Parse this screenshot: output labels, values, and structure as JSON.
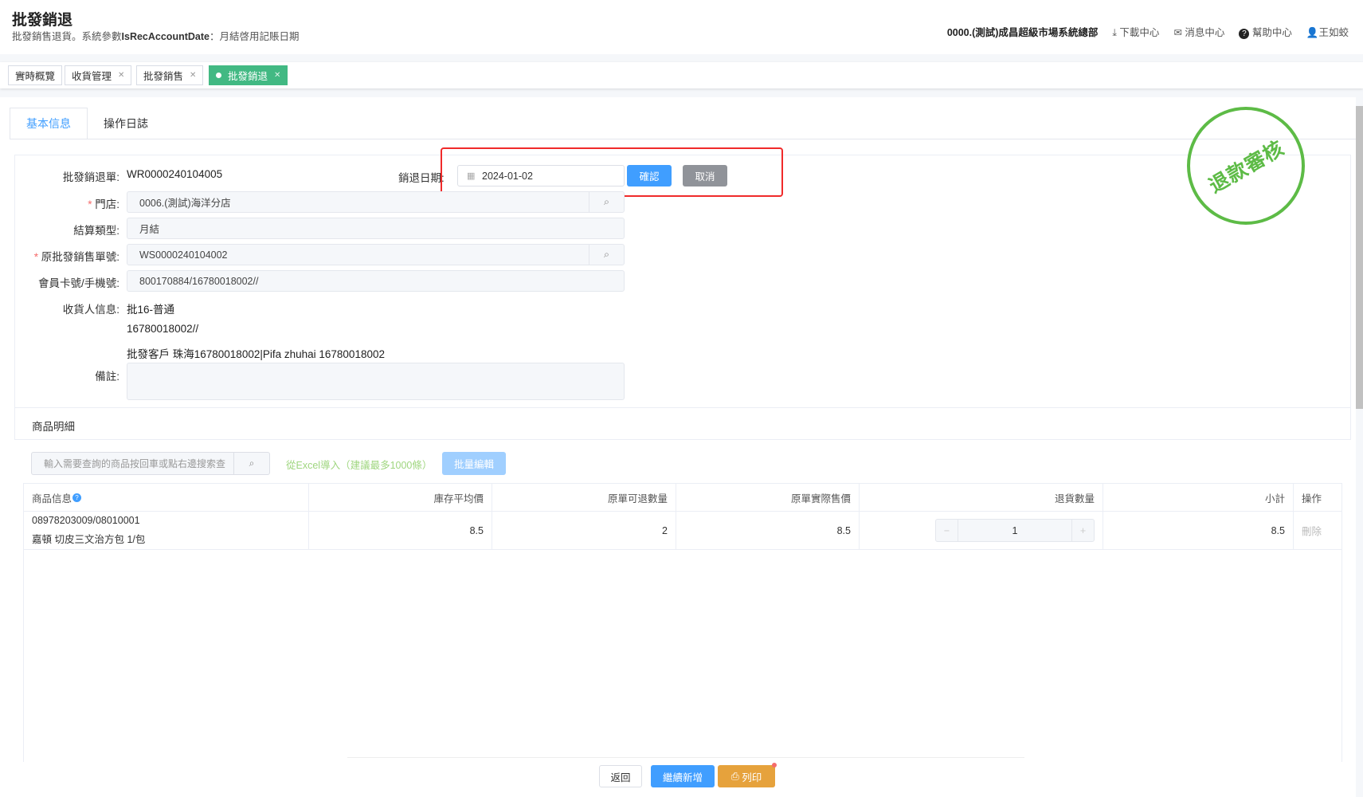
{
  "header": {
    "title": "批發銷退",
    "subtitle_prefix": "批發銷售退貨。系統參數",
    "subtitle_param": "IsRecAccountDate",
    "subtitle_suffix": "：月結啓用記賬日期",
    "org": "0000.(測試)成昌超級市場系統總部",
    "download": "下載中心",
    "messages": "消息中心",
    "help": "幫助中心",
    "user": "王如蛟"
  },
  "tabs": [
    {
      "label": "實時概覽"
    },
    {
      "label": "收貨管理"
    },
    {
      "label": "批發銷售"
    },
    {
      "label": "批發銷退",
      "active": true
    }
  ],
  "content_tabs": [
    "基本信息",
    "操作日誌"
  ],
  "form": {
    "order_label": "批發銷退單:",
    "order_value": "WR0000240104005",
    "date_label": "銷退日期:",
    "date_value": "2024-01-02",
    "confirm": "確認",
    "cancel": "取消",
    "store_label": "門店:",
    "store_value": "0006.(測試)海洋分店",
    "settle_label": "結算類型:",
    "settle_value": "月結",
    "orig_label": "原批發銷售單號:",
    "orig_value": "WS0000240104002",
    "member_label": "會員卡號/手機號:",
    "member_value": "800170884/16780018002//",
    "receiver_label": "收貨人信息:",
    "receiver_lines": [
      "批16-普通",
      "16780018002//",
      "批發客戶 珠海16780018002|Pifa zhuhai 16780018002"
    ],
    "remark_label": "備註:",
    "remark_value": ""
  },
  "stamp": "退款審核",
  "details": {
    "title": "商品明細",
    "search_placeholder": "輸入需要查詢的商品按回車或點右邊搜索查",
    "excel_import": "從Excel導入（建議最多1000條）",
    "batch_edit": "批量編輯",
    "columns": [
      "商品信息",
      "庫存平均價",
      "原單可退數量",
      "原單實際售價",
      "退貨數量",
      "小計",
      "操作"
    ],
    "rows": [
      {
        "code": "08978203009/08010001",
        "name": "嘉頓 切皮三文治方包 1/包",
        "avg_price": "8.5",
        "returnable": "2",
        "actual_price": "8.5",
        "qty": "1",
        "subtotal": "8.5",
        "action": "刪除"
      }
    ]
  },
  "footer": {
    "back": "返回",
    "continue": "繼續新增",
    "print": "列印"
  },
  "colors": {
    "primary": "#409eff",
    "success": "#42b983",
    "stamp": "#5dbb46",
    "highlight": "#f02a2a",
    "print": "#e6a23c"
  }
}
